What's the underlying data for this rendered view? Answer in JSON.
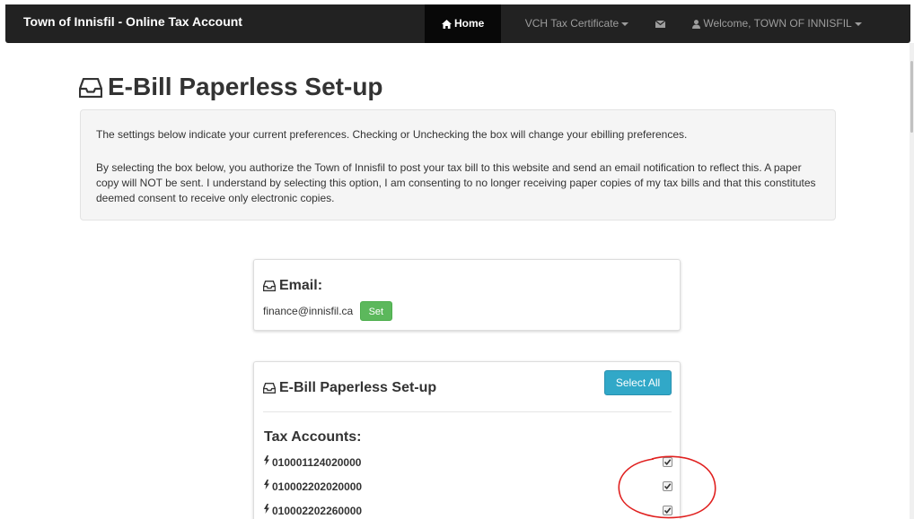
{
  "navbar": {
    "brand": "Town of Innisfil - Online Tax Account",
    "home_label": "Home",
    "vch_label": "VCH Tax Certificate",
    "welcome_label": "Welcome, TOWN OF INNISFIL"
  },
  "page": {
    "title": "E-Bill Paperless Set-up",
    "intro": "The settings below indicate your current preferences. Checking or Unchecking the box will change your ebilling preferences.",
    "consent": "By selecting the box below, you authorize the Town of Innisfil to post your tax bill to this website and send an email notification to reflect this. A paper copy will NOT be sent. I understand by selecting this option, I am consenting to no longer receiving paper copies of my tax bills and that this constitutes deemed consent to receive only electronic copies."
  },
  "email_panel": {
    "heading": "Email:",
    "email": "finance@innisfil.ca",
    "set_label": "Set"
  },
  "ebill_panel": {
    "heading": "E-Bill Paperless Set-up",
    "select_all_label": "Select All",
    "tax_accounts_label": "Tax Accounts:",
    "accounts": [
      {
        "number": "010001124020000",
        "checked": true
      },
      {
        "number": "010002202020000",
        "checked": true
      },
      {
        "number": "010002202260000",
        "checked": true
      }
    ]
  },
  "colors": {
    "navbar_bg": "#222222",
    "set_button": "#5cb85c",
    "select_all_button": "#31a8c8",
    "annotation_circle": "#e0201f"
  },
  "icons": {
    "home": "home-icon",
    "mail": "envelope-icon",
    "user": "user-icon",
    "inbox": "inbox-icon",
    "bolt": "flash-icon",
    "check": "checkmark-icon"
  }
}
